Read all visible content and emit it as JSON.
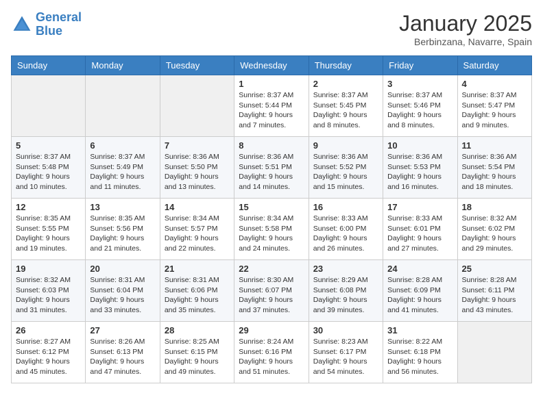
{
  "header": {
    "logo_line1": "General",
    "logo_line2": "Blue",
    "month": "January 2025",
    "location": "Berbinzana, Navarre, Spain"
  },
  "weekdays": [
    "Sunday",
    "Monday",
    "Tuesday",
    "Wednesday",
    "Thursday",
    "Friday",
    "Saturday"
  ],
  "weeks": [
    [
      {
        "day": "",
        "info": ""
      },
      {
        "day": "",
        "info": ""
      },
      {
        "day": "",
        "info": ""
      },
      {
        "day": "1",
        "info": "Sunrise: 8:37 AM\nSunset: 5:44 PM\nDaylight: 9 hours\nand 7 minutes."
      },
      {
        "day": "2",
        "info": "Sunrise: 8:37 AM\nSunset: 5:45 PM\nDaylight: 9 hours\nand 8 minutes."
      },
      {
        "day": "3",
        "info": "Sunrise: 8:37 AM\nSunset: 5:46 PM\nDaylight: 9 hours\nand 8 minutes."
      },
      {
        "day": "4",
        "info": "Sunrise: 8:37 AM\nSunset: 5:47 PM\nDaylight: 9 hours\nand 9 minutes."
      }
    ],
    [
      {
        "day": "5",
        "info": "Sunrise: 8:37 AM\nSunset: 5:48 PM\nDaylight: 9 hours\nand 10 minutes."
      },
      {
        "day": "6",
        "info": "Sunrise: 8:37 AM\nSunset: 5:49 PM\nDaylight: 9 hours\nand 11 minutes."
      },
      {
        "day": "7",
        "info": "Sunrise: 8:36 AM\nSunset: 5:50 PM\nDaylight: 9 hours\nand 13 minutes."
      },
      {
        "day": "8",
        "info": "Sunrise: 8:36 AM\nSunset: 5:51 PM\nDaylight: 9 hours\nand 14 minutes."
      },
      {
        "day": "9",
        "info": "Sunrise: 8:36 AM\nSunset: 5:52 PM\nDaylight: 9 hours\nand 15 minutes."
      },
      {
        "day": "10",
        "info": "Sunrise: 8:36 AM\nSunset: 5:53 PM\nDaylight: 9 hours\nand 16 minutes."
      },
      {
        "day": "11",
        "info": "Sunrise: 8:36 AM\nSunset: 5:54 PM\nDaylight: 9 hours\nand 18 minutes."
      }
    ],
    [
      {
        "day": "12",
        "info": "Sunrise: 8:35 AM\nSunset: 5:55 PM\nDaylight: 9 hours\nand 19 minutes."
      },
      {
        "day": "13",
        "info": "Sunrise: 8:35 AM\nSunset: 5:56 PM\nDaylight: 9 hours\nand 21 minutes."
      },
      {
        "day": "14",
        "info": "Sunrise: 8:34 AM\nSunset: 5:57 PM\nDaylight: 9 hours\nand 22 minutes."
      },
      {
        "day": "15",
        "info": "Sunrise: 8:34 AM\nSunset: 5:58 PM\nDaylight: 9 hours\nand 24 minutes."
      },
      {
        "day": "16",
        "info": "Sunrise: 8:33 AM\nSunset: 6:00 PM\nDaylight: 9 hours\nand 26 minutes."
      },
      {
        "day": "17",
        "info": "Sunrise: 8:33 AM\nSunset: 6:01 PM\nDaylight: 9 hours\nand 27 minutes."
      },
      {
        "day": "18",
        "info": "Sunrise: 8:32 AM\nSunset: 6:02 PM\nDaylight: 9 hours\nand 29 minutes."
      }
    ],
    [
      {
        "day": "19",
        "info": "Sunrise: 8:32 AM\nSunset: 6:03 PM\nDaylight: 9 hours\nand 31 minutes."
      },
      {
        "day": "20",
        "info": "Sunrise: 8:31 AM\nSunset: 6:04 PM\nDaylight: 9 hours\nand 33 minutes."
      },
      {
        "day": "21",
        "info": "Sunrise: 8:31 AM\nSunset: 6:06 PM\nDaylight: 9 hours\nand 35 minutes."
      },
      {
        "day": "22",
        "info": "Sunrise: 8:30 AM\nSunset: 6:07 PM\nDaylight: 9 hours\nand 37 minutes."
      },
      {
        "day": "23",
        "info": "Sunrise: 8:29 AM\nSunset: 6:08 PM\nDaylight: 9 hours\nand 39 minutes."
      },
      {
        "day": "24",
        "info": "Sunrise: 8:28 AM\nSunset: 6:09 PM\nDaylight: 9 hours\nand 41 minutes."
      },
      {
        "day": "25",
        "info": "Sunrise: 8:28 AM\nSunset: 6:11 PM\nDaylight: 9 hours\nand 43 minutes."
      }
    ],
    [
      {
        "day": "26",
        "info": "Sunrise: 8:27 AM\nSunset: 6:12 PM\nDaylight: 9 hours\nand 45 minutes."
      },
      {
        "day": "27",
        "info": "Sunrise: 8:26 AM\nSunset: 6:13 PM\nDaylight: 9 hours\nand 47 minutes."
      },
      {
        "day": "28",
        "info": "Sunrise: 8:25 AM\nSunset: 6:15 PM\nDaylight: 9 hours\nand 49 minutes."
      },
      {
        "day": "29",
        "info": "Sunrise: 8:24 AM\nSunset: 6:16 PM\nDaylight: 9 hours\nand 51 minutes."
      },
      {
        "day": "30",
        "info": "Sunrise: 8:23 AM\nSunset: 6:17 PM\nDaylight: 9 hours\nand 54 minutes."
      },
      {
        "day": "31",
        "info": "Sunrise: 8:22 AM\nSunset: 6:18 PM\nDaylight: 9 hours\nand 56 minutes."
      },
      {
        "day": "",
        "info": ""
      }
    ]
  ]
}
